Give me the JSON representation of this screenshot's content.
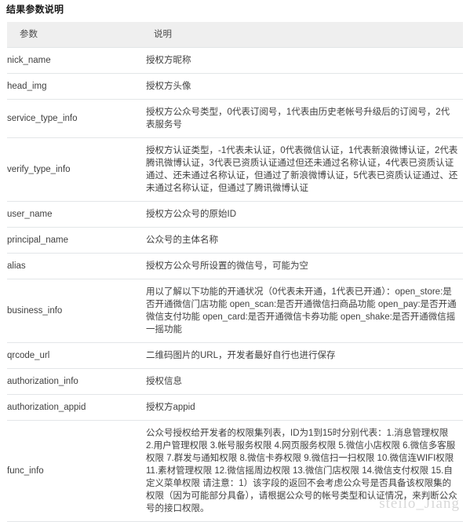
{
  "page": {
    "title": "结果参数说明"
  },
  "table": {
    "columns": [
      {
        "key": "param",
        "label": "参数"
      },
      {
        "key": "desc",
        "label": "说明"
      }
    ],
    "rows": [
      {
        "param": "nick_name",
        "desc": "授权方昵称"
      },
      {
        "param": "head_img",
        "desc": "授权方头像"
      },
      {
        "param": "service_type_info",
        "desc": "授权方公众号类型，0代表订阅号，1代表由历史老帐号升级后的订阅号，2代表服务号"
      },
      {
        "param": "verify_type_info",
        "desc": "授权方认证类型，-1代表未认证，0代表微信认证，1代表新浪微博认证，2代表腾讯微博认证，3代表已资质认证通过但还未通过名称认证，4代表已资质认证通过、还未通过名称认证，但通过了新浪微博认证，5代表已资质认证通过、还未通过名称认证，但通过了腾讯微博认证"
      },
      {
        "param": "user_name",
        "desc": "授权方公众号的原始ID"
      },
      {
        "param": "principal_name",
        "desc": "公众号的主体名称"
      },
      {
        "param": "alias",
        "desc": "授权方公众号所设置的微信号，可能为空"
      },
      {
        "param": "business_info",
        "desc": "用以了解以下功能的开通状况（0代表未开通，1代表已开通）：open_store:是否开通微信门店功能 open_scan:是否开通微信扫商品功能 open_pay:是否开通微信支付功能 open_card:是否开通微信卡券功能 open_shake:是否开通微信摇一摇功能"
      },
      {
        "param": "qrcode_url",
        "desc": "二维码图片的URL，开发者最好自行也进行保存"
      },
      {
        "param": "authorization_info",
        "desc": "授权信息"
      },
      {
        "param": "authorization_appid",
        "desc": "授权方appid"
      },
      {
        "param": "func_info",
        "desc": "公众号授权给开发者的权限集列表，ID为1到15时分别代表：1.消息管理权限 2.用户管理权限 3.帐号服务权限 4.网页服务权限 5.微信小店权限 6.微信多客服权限 7.群发与通知权限 8.微信卡券权限 9.微信扫一扫权限 10.微信连WIFI权限 11.素材管理权限 12.微信摇周边权限 13.微信门店权限 14.微信支付权限 15.自定义菜单权限 请注意：1）该字段的返回不会考虑公众号是否具备该权限集的权限（因为可能部分具备），请根据公众号的帐号类型和认证情况，来判断公众号的接口权限。"
      }
    ]
  },
  "watermark": {
    "text": "steilo_Jiang"
  },
  "colors": {
    "header_bg": "#efefef",
    "row_border": "#e3e6e8",
    "text": "#3f3f3f",
    "title": "#1a1a1a",
    "watermark": "#d8d8d8"
  }
}
